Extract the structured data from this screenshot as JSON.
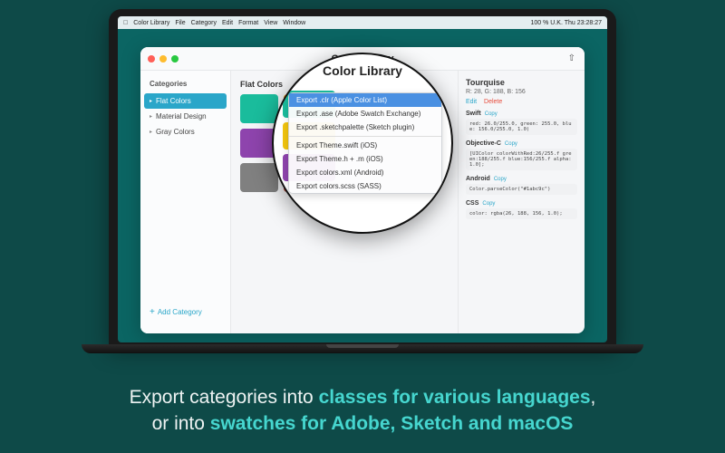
{
  "menubar": {
    "app": "Color Library",
    "items": [
      "File",
      "Category",
      "Edit",
      "Format",
      "View",
      "Window"
    ],
    "right": "100 %   U.K.   Thu 23:28:27"
  },
  "window": {
    "title": "Color Library"
  },
  "sidebar": {
    "heading": "Categories",
    "items": [
      {
        "label": "Flat Colors",
        "active": true
      },
      {
        "label": "Material Design",
        "active": false
      },
      {
        "label": "Gray Colors",
        "active": false
      }
    ],
    "add_label": "Add Category"
  },
  "main": {
    "section_title": "Flat Colors",
    "swatches": [
      "#1abc9c",
      "#f39c12",
      "#f1c40f",
      "#e74c3c",
      "#8e44ad",
      "#9b9b9b",
      "#bdbdbd",
      "#808080",
      "#808080",
      "#c0392b",
      "#c0392b",
      "#d35400"
    ]
  },
  "detail": {
    "name": "Tourquise",
    "rgb": "R: 28, G: 188, B: 156",
    "edit": "Edit",
    "delete": "Delete",
    "copy": "Copy",
    "groups": [
      {
        "label": "Swift",
        "code": "red: 26.0/255.0, green: 255.0, blue: 156.0/255.0, 1.0)"
      },
      {
        "label": "Objective-C",
        "code": "[UIColor colorWithRed:26/255.f green:188/255.f blue:156/255.f alpha:1.0];"
      },
      {
        "label": "Android",
        "code": "Color.parseColor(\"#1abc9c\")"
      },
      {
        "label": "CSS",
        "code": "color: rgba(26, 188, 156, 1.0);"
      }
    ]
  },
  "magnify": {
    "title": "Color Library",
    "swatches": [
      "#1abc9c",
      "#f1c40f",
      "#8e44ad"
    ],
    "menu_group1": [
      "Export .clr (Apple Color List)",
      "Export .ase (Adobe Swatch Exchange)",
      "Export .sketchpalette (Sketch plugin)"
    ],
    "menu_group2": [
      "Export Theme.swift (iOS)",
      "Export Theme.h + .m (iOS)",
      "Export colors.xml (Android)",
      "Export colors.scss (SASS)"
    ]
  },
  "caption": {
    "t1": "Export categories into ",
    "h1": "classes for various languages",
    "t2": ",",
    "t3": "or into ",
    "h2": "swatches for Adobe, Sketch and macOS"
  }
}
